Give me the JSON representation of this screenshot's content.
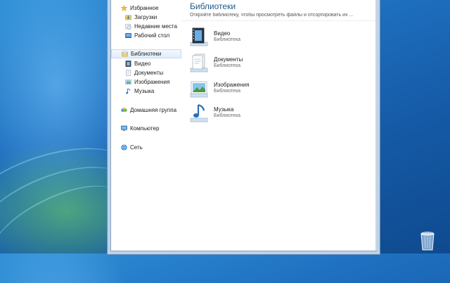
{
  "colors": {
    "accent": "#1e5a8a",
    "selection": "#dfeefc",
    "desktop": "#1e6fbf"
  },
  "nav": {
    "favorites": {
      "label": "Избранное",
      "icon": "star-icon",
      "items": [
        {
          "label": "Загрузки",
          "icon": "downloads-folder-icon"
        },
        {
          "label": "Недавние места",
          "icon": "recent-places-icon"
        },
        {
          "label": "Рабочий стол",
          "icon": "desktop-icon"
        }
      ]
    },
    "libraries": {
      "label": "Библиотеки",
      "icon": "libraries-icon",
      "items": [
        {
          "label": "Видео",
          "icon": "video-library-icon"
        },
        {
          "label": "Документы",
          "icon": "documents-library-icon"
        },
        {
          "label": "Изображения",
          "icon": "pictures-library-icon"
        },
        {
          "label": "Музыка",
          "icon": "music-library-icon"
        }
      ]
    },
    "homegroup": {
      "label": "Домашняя группа",
      "icon": "homegroup-icon"
    },
    "computer": {
      "label": "Компьютер",
      "icon": "computer-icon"
    },
    "network": {
      "label": "Сеть",
      "icon": "network-icon"
    }
  },
  "content": {
    "title": "Библиотеки",
    "subtitle": "Откройте библиотеку, чтобы просмотреть файлы и отсортировать их ...",
    "libraries": [
      {
        "name": "Видео",
        "type": "Библиотека",
        "icon": "video-library-icon"
      },
      {
        "name": "Документы",
        "type": "Библиотека",
        "icon": "documents-library-icon"
      },
      {
        "name": "Изображения",
        "type": "Библиотека",
        "icon": "pictures-library-icon"
      },
      {
        "name": "Музыка",
        "type": "Библиотека",
        "icon": "music-library-icon"
      }
    ]
  },
  "desktop": {
    "recycle_bin_icon": "recycle-bin-icon"
  }
}
